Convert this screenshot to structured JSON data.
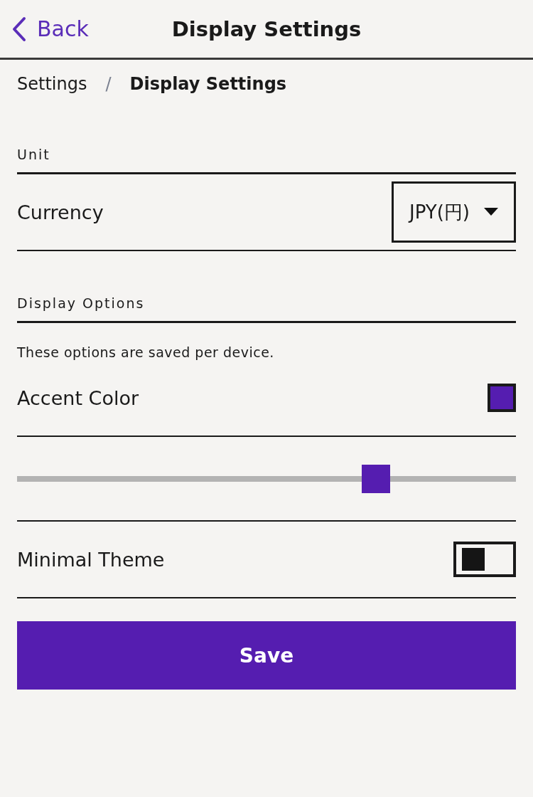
{
  "nav": {
    "back": "Back",
    "title": "Display Settings"
  },
  "breadcrumb": [
    {
      "label": "Settings",
      "current": false
    },
    {
      "label": "Display Settings",
      "current": true
    }
  ],
  "breadcrumb_separator": "/",
  "sections": [
    {
      "title": "Unit",
      "rows": [
        {
          "kind": "select",
          "label": "Currency",
          "value": "JPY(円)"
        }
      ]
    },
    {
      "title": "Display Options",
      "note": "These options are saved per device.",
      "rows": [
        {
          "kind": "color",
          "label": "Accent Color",
          "color": "#551db0"
        },
        {
          "kind": "slider",
          "level": 0.72
        },
        {
          "kind": "toggle",
          "label": "Minimal Theme",
          "on": false
        }
      ]
    }
  ],
  "save": "Save"
}
